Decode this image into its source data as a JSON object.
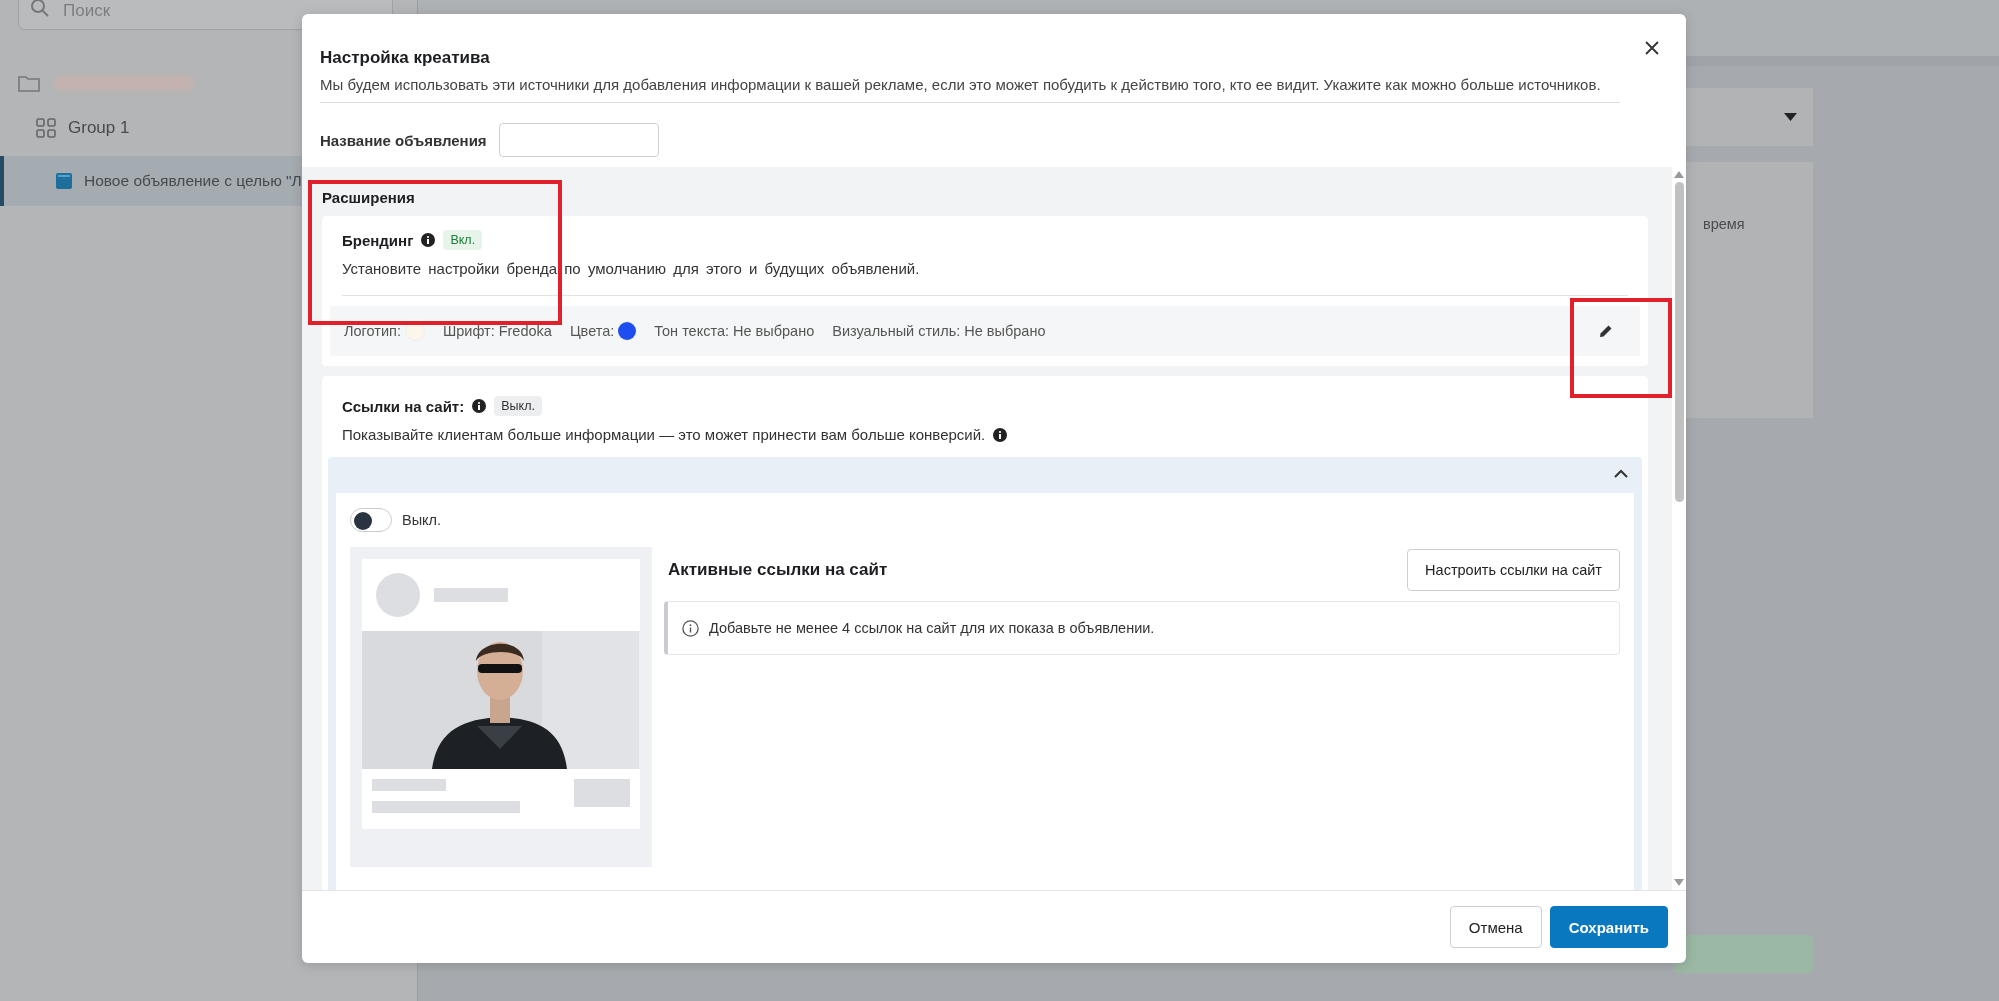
{
  "sidebar": {
    "search": {
      "placeholder": "Поиск"
    },
    "items": [
      {
        "label": "Group 1",
        "kind": "group",
        "selected": false
      },
      {
        "label": "Новое объявление с целью \"Л",
        "kind": "ad",
        "selected": true
      }
    ]
  },
  "background": {
    "card_lines": [
      "время"
    ]
  },
  "dialog": {
    "title": "Настройка креатива",
    "description": "Мы будем использовать эти источники для добавления информации к вашей рекламе, если это может побудить к действию того, кто ее видит. Укажите как можно больше источников.",
    "name_field": {
      "label": "Название объявления"
    },
    "section_title": "Расширения",
    "branding": {
      "title": "Брендинг",
      "status": "Вкл.",
      "on": true,
      "description": "Установите настройки бренда по умолчанию для этого и будущих объявлений.",
      "settings": [
        {
          "label": "Логотип:",
          "kind": "logo"
        },
        {
          "label": "Шрифт: Fredoka",
          "kind": "text"
        },
        {
          "label": "Цвета:",
          "kind": "color",
          "color": "#1f4ef0"
        },
        {
          "label": "Тон текста: Не выбрано",
          "kind": "text"
        },
        {
          "label": "Визуальный стиль: Не выбрано",
          "kind": "text"
        }
      ]
    },
    "site_links": {
      "title": "Ссылки на сайт:",
      "status": "Выкл.",
      "on": false,
      "description": "Показывайте клиентам больше информации — это может принести вам больше конверсий.",
      "expanded": true,
      "toggle": {
        "label": "Выкл.",
        "on": false
      },
      "active_title": "Активные ссылки на сайт",
      "configure_button": "Настроить ссылки на сайт",
      "notice": "Добавьте не менее 4 ссылок на сайт для их показа в объявлении."
    },
    "buttons": [
      {
        "label": "Отмена",
        "kind": "secondary"
      },
      {
        "label": "Сохранить",
        "kind": "primary"
      }
    ]
  }
}
